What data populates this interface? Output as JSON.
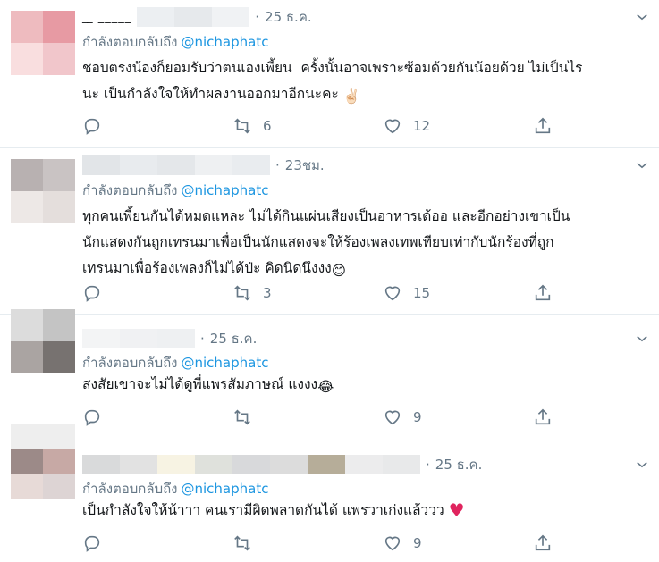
{
  "colors": {
    "accent": "#1b95e0",
    "muted": "#657786",
    "text": "#14171a",
    "heart": "#e0245e"
  },
  "tweets": [
    {
      "time": "25 ธ.ค.",
      "reply_label": "กำลังตอบกลับถึง",
      "handle": "@nichaphatc",
      "text": "ชอบตรงน้องก็ยอมรับว่าตนเองเพี้ยน  ครั้งนั้นอาจเพราะซ้อมด้วยกันน้อยด้วย ไม่เป็นไร\nนะ เป็นกำลังใจให้ทำผลงานออกมาอีกนะคะ",
      "emoji": "✌🏻",
      "reply_count": "",
      "retweet_count": "6",
      "like_count": "12"
    },
    {
      "time": "23ชม.",
      "reply_label": "กำลังตอบกลับถึง",
      "handle": "@nichaphatc",
      "text": "ทุกคนเพี้ยนกันได้หมดแหละ ไม่ได้กินแผ่นเสียงเป็นอาหารเด้ออ และอีกอย่างเขาเป็น\nนักแสดงกันถูกเทรนมาเพื่อเป็นนักแสดงจะให้ร้องเพลงเทพเทียบเท่ากับนักร้องที่ถูก\nเทรนมาเพื่อร้องเพลงก็ไม่ได้ป่ะ คิดนิดนึงงง",
      "emoji": "😊",
      "reply_count": "",
      "retweet_count": "3",
      "like_count": "15"
    },
    {
      "time": "25 ธ.ค.",
      "reply_label": "กำลังตอบกลับถึง",
      "handle": "@nichaphatc",
      "text": "สงสัยเขาจะไม่ได้ดูพี่แพรสัมภาษณ์ แงงง",
      "emoji": "😂",
      "reply_count": "",
      "retweet_count": "",
      "like_count": "9"
    },
    {
      "time": "25 ธ.ค.",
      "reply_label": "กำลังตอบกลับถึง",
      "handle": "@nichaphatc",
      "text": "เป็นกำลังใจให้น้าาา คนเรามีผิดพลาดกันได้ แพรวาเก่งแล้ววว",
      "emoji": "♥",
      "reply_count": "",
      "retweet_count": "",
      "like_count": "9"
    }
  ]
}
